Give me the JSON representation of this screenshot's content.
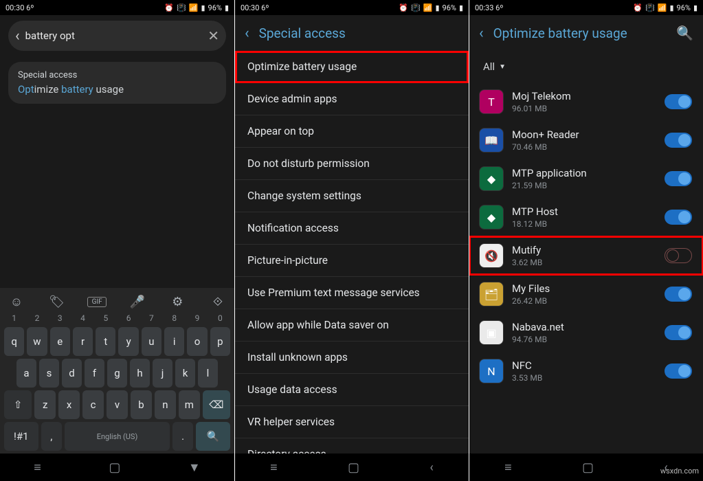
{
  "status1": {
    "time": "00:30",
    "temp": "6º",
    "battery": "96%"
  },
  "status2": {
    "time": "00:30",
    "temp": "6º",
    "battery": "96%"
  },
  "status3": {
    "time": "00:33",
    "temp": "6º",
    "battery": "96%"
  },
  "screen1": {
    "search_value": "battery opt",
    "result_top": "Special access",
    "result_prefix": "Opt",
    "result_mid1": "imize ",
    "result_hl2": "battery",
    "result_suffix": " usage",
    "keyboard_lang": "English (US)",
    "numrow": [
      "1",
      "2",
      "3",
      "4",
      "5",
      "6",
      "7",
      "8",
      "9",
      "0"
    ],
    "row1": [
      "q",
      "w",
      "e",
      "r",
      "t",
      "y",
      "u",
      "i",
      "o",
      "p"
    ],
    "row2": [
      "a",
      "s",
      "d",
      "f",
      "g",
      "h",
      "j",
      "k",
      "l"
    ],
    "row3_shift": "⇧",
    "row3": [
      "z",
      "x",
      "c",
      "v",
      "b",
      "n",
      "m"
    ],
    "row3_back": "⌫",
    "sym": "!#1",
    "comma": ",",
    "dot": ".",
    "search": "Q"
  },
  "screen2": {
    "title": "Special access",
    "items": [
      "Optimize battery usage",
      "Device admin apps",
      "Appear on top",
      "Do not disturb permission",
      "Change system settings",
      "Notification access",
      "Picture-in-picture",
      "Use Premium text message services",
      "Allow app while Data saver on",
      "Install unknown apps",
      "Usage data access",
      "VR helper services",
      "Directory access"
    ]
  },
  "screen3": {
    "title": "Optimize battery usage",
    "filter": "All",
    "apps": [
      {
        "name": "Moj Telekom",
        "size": "96.01 MB",
        "on": true,
        "glyph": "T",
        "bg": "#b00060"
      },
      {
        "name": "Moon+ Reader",
        "size": "70.46 MB",
        "on": true,
        "glyph": "📖",
        "bg": "#1a4fa6"
      },
      {
        "name": "MTP application",
        "size": "21.59 MB",
        "on": true,
        "glyph": "◆",
        "bg": "#0c6b3e"
      },
      {
        "name": "MTP Host",
        "size": "18.12 MB",
        "on": true,
        "glyph": "◆",
        "bg": "#0c6b3e"
      },
      {
        "name": "Mutify",
        "size": "3.62 MB",
        "on": false,
        "glyph": "🔇",
        "bg": "#efefef",
        "highlight": true
      },
      {
        "name": "My Files",
        "size": "26.42 MB",
        "on": true,
        "glyph": "🗂",
        "bg": "#caa132"
      },
      {
        "name": "Nabava.net",
        "size": "94.76 MB",
        "on": true,
        "glyph": "▣",
        "bg": "#eaeaea"
      },
      {
        "name": "NFC",
        "size": "3.53 MB",
        "on": true,
        "glyph": "N",
        "bg": "#1d6fc4"
      }
    ]
  },
  "watermark": "wsxdn.com"
}
